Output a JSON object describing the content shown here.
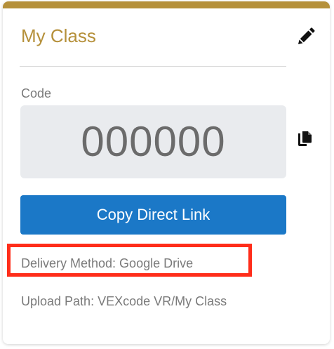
{
  "card": {
    "title": "My Class",
    "accent_color": "#b5903a",
    "edit_icon": "pencil-icon",
    "code_label": "Code",
    "code_value": "000000",
    "copy_icon": "copy-icon",
    "copy_link_label": "Copy Direct Link",
    "button_color": "#1b78c7",
    "delivery_method": "Delivery Method: Google Drive",
    "upload_path": "Upload Path: VEXcode VR/My Class"
  },
  "annotation": {
    "highlight_color": "#ff2d1a"
  }
}
